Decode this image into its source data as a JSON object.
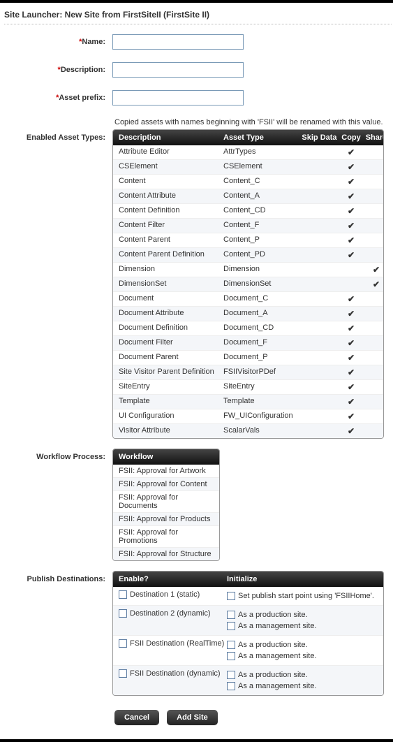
{
  "title": "Site Launcher: New Site from FirstSiteII (FirstSite II)",
  "fields": {
    "name": {
      "label": "Name:",
      "value": ""
    },
    "description": {
      "label": "Description:",
      "value": ""
    },
    "prefix": {
      "label": "Asset prefix:",
      "value": ""
    }
  },
  "required_marker": "*",
  "note": "Copied assets with names beginning with 'FSII' will be renamed with this value.",
  "sections": {
    "assetTypes": "Enabled Asset Types:",
    "workflow": "Workflow Process:",
    "publish": "Publish Destinations:"
  },
  "assetTable": {
    "headers": {
      "desc": "Description",
      "type": "Asset Type",
      "skip": "Skip Data",
      "copy": "Copy",
      "share": "Share"
    },
    "rows": [
      {
        "desc": "Attribute Editor",
        "type": "AttrTypes",
        "copy": true,
        "share": false
      },
      {
        "desc": "CSElement",
        "type": "CSElement",
        "copy": true,
        "share": false
      },
      {
        "desc": "Content",
        "type": "Content_C",
        "copy": true,
        "share": false
      },
      {
        "desc": "Content Attribute",
        "type": "Content_A",
        "copy": true,
        "share": false
      },
      {
        "desc": "Content Definition",
        "type": "Content_CD",
        "copy": true,
        "share": false
      },
      {
        "desc": "Content Filter",
        "type": "Content_F",
        "copy": true,
        "share": false
      },
      {
        "desc": "Content Parent",
        "type": "Content_P",
        "copy": true,
        "share": false
      },
      {
        "desc": "Content Parent Definition",
        "type": "Content_PD",
        "copy": true,
        "share": false
      },
      {
        "desc": "Dimension",
        "type": "Dimension",
        "copy": false,
        "share": true
      },
      {
        "desc": "DimensionSet",
        "type": "DimensionSet",
        "copy": false,
        "share": true
      },
      {
        "desc": "Document",
        "type": "Document_C",
        "copy": true,
        "share": false
      },
      {
        "desc": "Document Attribute",
        "type": "Document_A",
        "copy": true,
        "share": false
      },
      {
        "desc": "Document Definition",
        "type": "Document_CD",
        "copy": true,
        "share": false
      },
      {
        "desc": "Document Filter",
        "type": "Document_F",
        "copy": true,
        "share": false
      },
      {
        "desc": "Document Parent",
        "type": "Document_P",
        "copy": true,
        "share": false
      },
      {
        "desc": "Site Visitor Parent Definition",
        "type": "FSIIVisitorPDef",
        "copy": true,
        "share": false
      },
      {
        "desc": "SiteEntry",
        "type": "SiteEntry",
        "copy": true,
        "share": false
      },
      {
        "desc": "Template",
        "type": "Template",
        "copy": true,
        "share": false
      },
      {
        "desc": "UI Configuration",
        "type": "FW_UIConfiguration",
        "copy": true,
        "share": false
      },
      {
        "desc": "Visitor Attribute",
        "type": "ScalarVals",
        "copy": true,
        "share": false
      }
    ]
  },
  "workflow": {
    "header": "Workflow",
    "items": [
      "FSII: Approval for Artwork",
      "FSII: Approval for Content",
      "FSII: Approval for Documents",
      "FSII: Approval for Products",
      "FSII: Approval for Promotions",
      "FSII: Approval for Structure"
    ]
  },
  "publish": {
    "headers": {
      "enable": "Enable?",
      "init": "Initialize"
    },
    "rows": [
      {
        "name": "Destination 1 (static)",
        "opts": [
          "Set publish start point using 'FSIIHome'."
        ]
      },
      {
        "name": "Destination 2 (dynamic)",
        "opts": [
          "As a production site.",
          "As a management site."
        ]
      },
      {
        "name": "FSII Destination (RealTime)",
        "opts": [
          "As a production site.",
          "As a management site."
        ]
      },
      {
        "name": "FSII Destination (dynamic)",
        "opts": [
          "As a production site.",
          "As a management site."
        ]
      }
    ]
  },
  "buttons": {
    "cancel": "Cancel",
    "add": "Add Site"
  },
  "check_glyph": "✔"
}
